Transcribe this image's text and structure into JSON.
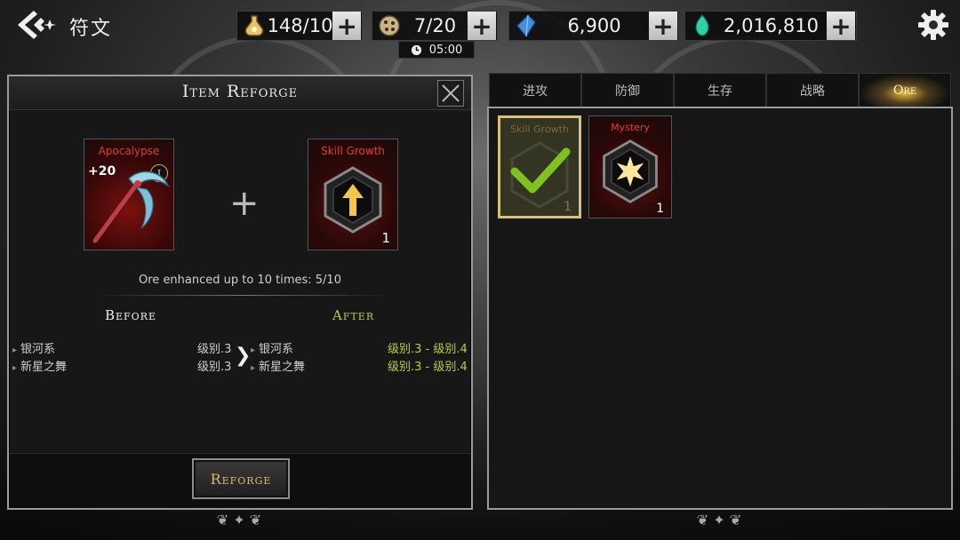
{
  "header": {
    "title": "符文",
    "resources": [
      {
        "icon": "potion-icon",
        "value": "148/10"
      },
      {
        "icon": "dice-icon",
        "value": "7/20"
      },
      {
        "icon": "blue-crystal-icon",
        "value": "6,900"
      },
      {
        "icon": "green-crystal-icon",
        "value": "2,016,810"
      }
    ],
    "timer": "05:00"
  },
  "reforge": {
    "title": "Item Reforge",
    "item": {
      "name": "Apocalypse",
      "level": "+20",
      "tier": "I"
    },
    "rune": {
      "name": "Skill Growth",
      "count": "1"
    },
    "enhance_text": "Ore enhanced up to 10 times: 5/10",
    "before_label": "Before",
    "after_label": "After",
    "stats": [
      {
        "name": "银河系",
        "before": "级别.3",
        "after_name": "银河系",
        "after": "级别.3 - 级别.4"
      },
      {
        "name": "新星之舞",
        "before": "级别.3",
        "after_name": "新星之舞",
        "after": "级别.3 - 级别.4"
      }
    ],
    "button": "Reforge"
  },
  "tabs": [
    {
      "label": "进攻"
    },
    {
      "label": "防御"
    },
    {
      "label": "生存"
    },
    {
      "label": "战略"
    },
    {
      "label": "Ore"
    }
  ],
  "inventory": [
    {
      "name": "Skill Growth",
      "count": "1",
      "selected": true
    },
    {
      "name": "Mystery",
      "count": "1",
      "selected": false
    }
  ],
  "colors": {
    "accent_gold": "#e0b472",
    "stat_green": "#b8cc3c",
    "rune_name_red": "#e0402a"
  }
}
